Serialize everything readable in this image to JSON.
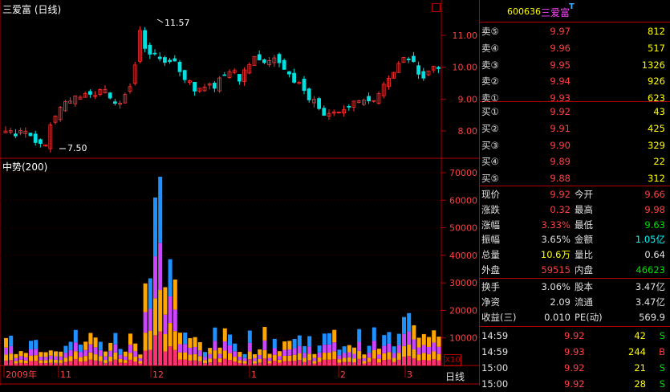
{
  "stock": {
    "code": "600636",
    "name": "三爱富",
    "tag": "T",
    "period_label": "三爱富 (日线)"
  },
  "sub_panel_label": "中势(200)",
  "scale_label": "X10",
  "period_button": "日线",
  "price_annotations": {
    "high": "11.57",
    "low": "7.50"
  },
  "price_axis": [
    "11.00",
    "10.00",
    "9.00",
    "8.00"
  ],
  "volume_axis": [
    "70000",
    "60000",
    "50000",
    "40000",
    "30000",
    "20000",
    "10000"
  ],
  "time_axis": [
    "2009年",
    "11",
    "12",
    "1",
    "2",
    "3"
  ],
  "colors": {
    "up": "#ff3030",
    "down": "#00e0e0",
    "grid": "#b00000",
    "orange": "#ffa500",
    "magenta": "#cc44ff",
    "blue": "#1e90ff",
    "pink": "#ff3070"
  },
  "order_book": {
    "sell": [
      {
        "label": "卖⑤",
        "price": "9.97",
        "volume": "812"
      },
      {
        "label": "卖④",
        "price": "9.96",
        "volume": "517"
      },
      {
        "label": "卖③",
        "price": "9.95",
        "volume": "1326"
      },
      {
        "label": "卖②",
        "price": "9.94",
        "volume": "926"
      },
      {
        "label": "卖①",
        "price": "9.93",
        "volume": "623"
      }
    ],
    "buy": [
      {
        "label": "买①",
        "price": "9.92",
        "volume": "43"
      },
      {
        "label": "买②",
        "price": "9.91",
        "volume": "425"
      },
      {
        "label": "买③",
        "price": "9.90",
        "volume": "329"
      },
      {
        "label": "买④",
        "price": "9.89",
        "volume": "22"
      },
      {
        "label": "买⑤",
        "price": "9.88",
        "volume": "312"
      }
    ]
  },
  "quote": [
    {
      "l1": "现价",
      "v1": "9.92",
      "l2": "今开",
      "v2": "9.66"
    },
    {
      "l1": "涨跌",
      "v1": "0.32",
      "l2": "最高",
      "v2": "9.98"
    },
    {
      "l1": "涨幅",
      "v1": "3.33%",
      "l2": "最低",
      "v2": "9.63"
    },
    {
      "l1": "振幅",
      "v1": "3.65%",
      "l2": "金额",
      "v2": "1.05亿"
    },
    {
      "l1": "总量",
      "v1": "10.6万",
      "l2": "量比",
      "v2": "0.64"
    },
    {
      "l1": "外盘",
      "v1": "59515",
      "l2": "内盘",
      "v2": "46623"
    }
  ],
  "fundamentals": [
    {
      "l1": "换手",
      "v1": "3.06%",
      "l2": "股本",
      "v2": "3.47亿"
    },
    {
      "l1": "净资",
      "v1": "2.09",
      "l2": "流通",
      "v2": "3.47亿"
    },
    {
      "l1": "收益(三)",
      "v1": "0.010",
      "l2": "PE(动)",
      "v2": "569.9"
    }
  ],
  "trades": [
    {
      "time": "14:59",
      "price": "9.92",
      "volume": "42",
      "side": "S"
    },
    {
      "time": "14:59",
      "price": "9.93",
      "volume": "244",
      "side": "B"
    },
    {
      "time": "15:00",
      "price": "9.92",
      "volume": "21",
      "side": "S"
    },
    {
      "time": "15:00",
      "price": "9.92",
      "volume": "28",
      "side": "S"
    }
  ]
}
